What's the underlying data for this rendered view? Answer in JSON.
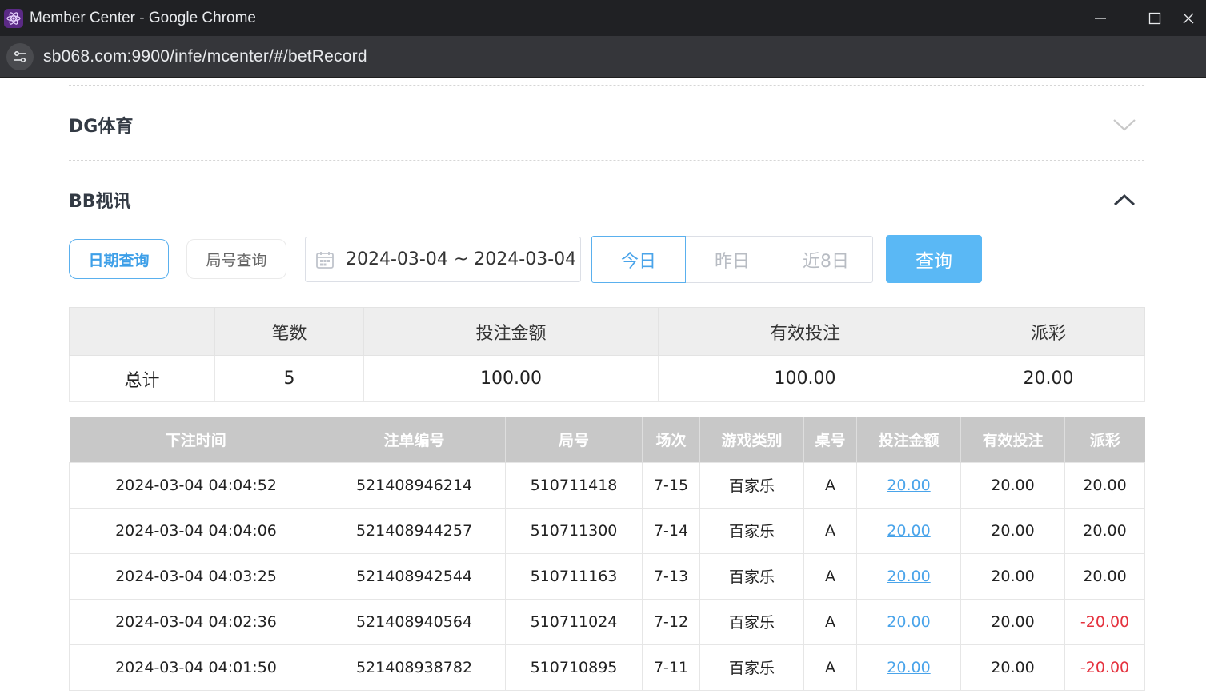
{
  "window": {
    "title": "Member Center - Google Chrome",
    "url": "sb068.com:9900/infe/mcenter/#/betRecord"
  },
  "sections": {
    "dg": {
      "title": "DG体育"
    },
    "bb": {
      "title": "BB视讯"
    }
  },
  "filters": {
    "date_query": "日期查询",
    "round_query": "局号查询",
    "date_range": "2024-03-04 ~ 2024-03-04",
    "today": "今日",
    "yesterday": "昨日",
    "last8": "近8日",
    "search": "查询"
  },
  "summary": {
    "headers": [
      "",
      "笔数",
      "投注金额",
      "有效投注",
      "派彩"
    ],
    "row": [
      "总计",
      "5",
      "100.00",
      "100.00",
      "20.00"
    ]
  },
  "records": {
    "headers": [
      "下注时间",
      "注单编号",
      "局号",
      "场次",
      "游戏类别",
      "桌号",
      "投注金额",
      "有效投注",
      "派彩"
    ],
    "rows": [
      [
        "2024-03-04 04:04:52",
        "521408946214",
        "510711418",
        "7-15",
        "百家乐",
        "A",
        "20.00",
        "20.00",
        "20.00"
      ],
      [
        "2024-03-04 04:04:06",
        "521408944257",
        "510711300",
        "7-14",
        "百家乐",
        "A",
        "20.00",
        "20.00",
        "20.00"
      ],
      [
        "2024-03-04 04:03:25",
        "521408942544",
        "510711163",
        "7-13",
        "百家乐",
        "A",
        "20.00",
        "20.00",
        "20.00"
      ],
      [
        "2024-03-04 04:02:36",
        "521408940564",
        "510711024",
        "7-12",
        "百家乐",
        "A",
        "20.00",
        "20.00",
        "-20.00"
      ],
      [
        "2024-03-04 04:01:50",
        "521408938782",
        "510710895",
        "7-11",
        "百家乐",
        "A",
        "20.00",
        "20.00",
        "-20.00"
      ]
    ]
  },
  "colors": {
    "accent": "#4aa4ea",
    "negative": "#e5323e",
    "search_button": "#5ab8f5"
  }
}
